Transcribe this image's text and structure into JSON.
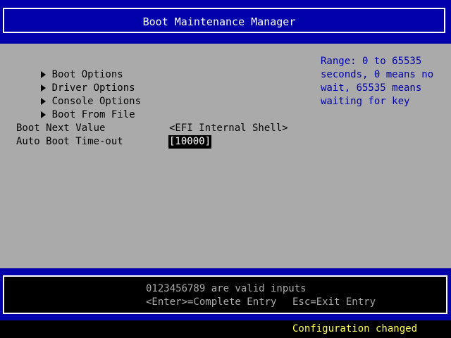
{
  "header": {
    "title": "Boot Maintenance Manager"
  },
  "menu": {
    "items": [
      {
        "label": "Boot Options"
      },
      {
        "label": "Driver Options"
      },
      {
        "label": "Console Options"
      },
      {
        "label": "Boot From File"
      }
    ]
  },
  "fields": {
    "boot_next": {
      "label": "Boot Next Value",
      "value": "<EFI Internal Shell>"
    },
    "auto_boot_timeout": {
      "label": "Auto Boot Time-out",
      "value": "[10000]"
    }
  },
  "help": {
    "lines": [
      "Range: 0 to 65535",
      "seconds, 0 means no",
      "wait, 65535 means",
      "waiting for key"
    ]
  },
  "footer": {
    "valid_inputs": "0123456789 are valid inputs",
    "enter_hint": "<Enter>=Complete Entry",
    "esc_hint": "Esc=Exit Entry"
  },
  "status": {
    "message": "Configuration changed"
  },
  "colors": {
    "header_bg": "#0000aa",
    "main_bg": "#aaaaaa",
    "help_text": "#0000aa",
    "status_text": "#ffff55",
    "footer_text": "#aaaaaa"
  },
  "icons": {
    "menu_arrow": "right-triangle-icon"
  }
}
